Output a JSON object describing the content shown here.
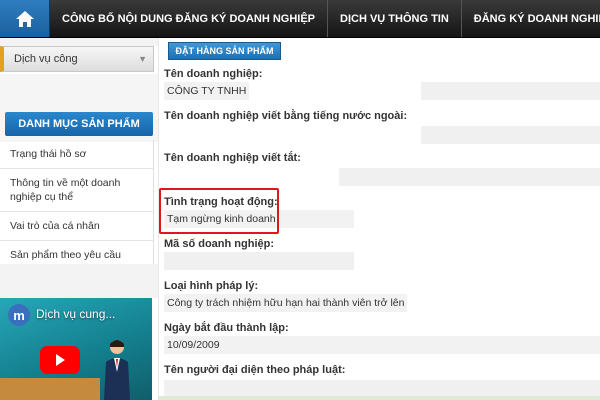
{
  "nav": {
    "items": [
      "CÔNG BỐ NỘI DUNG ĐĂNG KÝ DOANH NGHIỆP",
      "DỊCH VỤ THÔNG TIN",
      "ĐĂNG KÝ DOANH NGHIỆP QUA MẠNG ĐIỆ"
    ]
  },
  "sidebar": {
    "dropdown_label": "Dịch vụ công",
    "menu_title": "DANH MỤC SẢN PHẨM",
    "menu_items": [
      "Trạng thái hồ sơ",
      "Thông tin về một doanh nghiệp cụ thể",
      "Vai trò của cá nhân",
      "Sản phẩm theo yêu cầu"
    ],
    "video": {
      "channel_initial": "m",
      "title": "Dịch vụ cung..."
    }
  },
  "main": {
    "order_button": "ĐẶT HÀNG SẢN PHẨM",
    "fields": [
      {
        "label": "Tên doanh nghiệp:",
        "value": "CÔNG TY TNHH"
      },
      {
        "label": "Tên doanh nghiệp viết bằng tiếng nước ngoài:",
        "value": ""
      },
      {
        "label": "Tên doanh nghiệp viết tắt:",
        "value": ""
      },
      {
        "label": "Tình trạng hoạt động:",
        "value": "Tạm ngừng kinh doanh"
      },
      {
        "label": "Mã số doanh nghiệp:",
        "value": ""
      },
      {
        "label": "Loại hình pháp lý:",
        "value": "Công ty trách nhiệm hữu hạn hai thành viên trở lên"
      },
      {
        "label": "Ngày bắt đầu thành lập:",
        "value": "10/09/2009"
      },
      {
        "label": "Tên người đại diện theo pháp luật:",
        "value": ""
      }
    ]
  },
  "colors": {
    "nav_bg": "#1e1e1e",
    "accent_blue": "#1f6fb0",
    "highlight_red": "#e0161b"
  }
}
